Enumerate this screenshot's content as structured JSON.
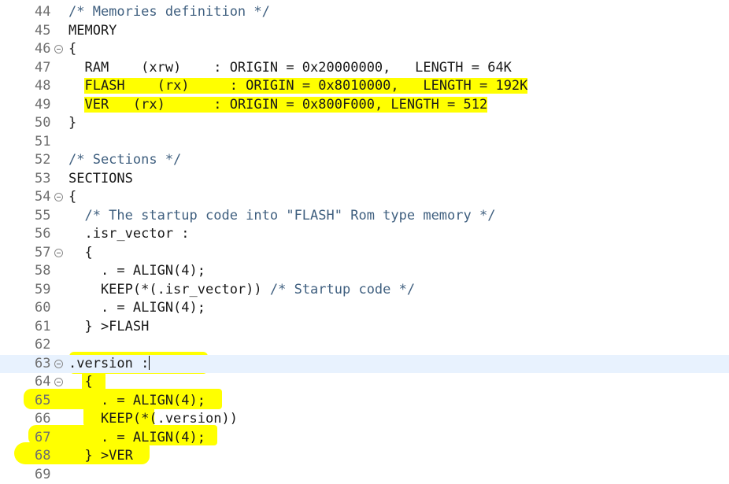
{
  "editor": {
    "lines": [
      {
        "num": "44",
        "text": "/* Memories definition */",
        "kind": "comment"
      },
      {
        "num": "45",
        "text": "MEMORY",
        "kind": "code"
      },
      {
        "num": "46",
        "text": "{",
        "kind": "code",
        "fold": true
      },
      {
        "num": "47",
        "text": "  RAM    (xrw)    : ORIGIN = 0x20000000,   LENGTH = 64K",
        "kind": "code"
      },
      {
        "num": "48",
        "text": "  FLASH    (rx)     : ORIGIN = 0x8010000,   LENGTH = 192K",
        "kind": "code",
        "highlight": true
      },
      {
        "num": "49",
        "text": "  VER   (rx)      : ORIGIN = 0x800F000, LENGTH = 512",
        "kind": "code",
        "highlight": true
      },
      {
        "num": "50",
        "text": "}",
        "kind": "code"
      },
      {
        "num": "51",
        "text": "",
        "kind": "code"
      },
      {
        "num": "52",
        "text": "/* Sections */",
        "kind": "comment"
      },
      {
        "num": "53",
        "text": "SECTIONS",
        "kind": "code"
      },
      {
        "num": "54",
        "text": "{",
        "kind": "code",
        "fold": true
      },
      {
        "num": "55",
        "text": "  /* The startup code into \"FLASH\" Rom type memory */",
        "kind": "comment"
      },
      {
        "num": "56",
        "text": "  .isr_vector :",
        "kind": "code"
      },
      {
        "num": "57",
        "text": "  {",
        "kind": "code",
        "fold": true
      },
      {
        "num": "58",
        "text": "    . = ALIGN(4);",
        "kind": "code"
      },
      {
        "num": "59",
        "text": "    KEEP(*(.isr_vector)) /* Startup code */",
        "kind": "mixed",
        "code_part": "    KEEP(*(.isr_vector)) ",
        "comment_part": "/* Startup code */"
      },
      {
        "num": "60",
        "text": "    . = ALIGN(4);",
        "kind": "code"
      },
      {
        "num": "61",
        "text": "  } >FLASH",
        "kind": "code"
      },
      {
        "num": "62",
        "text": "",
        "kind": "code"
      },
      {
        "num": "63",
        "text": ".version :",
        "kind": "code",
        "fold": true,
        "current": true,
        "caret": true
      },
      {
        "num": "64",
        "text": "  {",
        "kind": "code",
        "fold": true
      },
      {
        "num": "65",
        "text": "    . = ALIGN(4);",
        "kind": "code"
      },
      {
        "num": "66",
        "text": "    KEEP(*(.version))",
        "kind": "code"
      },
      {
        "num": "67",
        "text": "    . = ALIGN(4);",
        "kind": "code"
      },
      {
        "num": "68",
        "text": "  } >VER",
        "kind": "code"
      },
      {
        "num": "69",
        "text": "",
        "kind": "code"
      }
    ]
  },
  "colors": {
    "background": "#ffffff",
    "comment": "#3f5f7f",
    "code": "#1a1a1a",
    "line_number": "#6f6f6f",
    "highlight": "#ffff00",
    "current_line": "#e8f2fe"
  }
}
